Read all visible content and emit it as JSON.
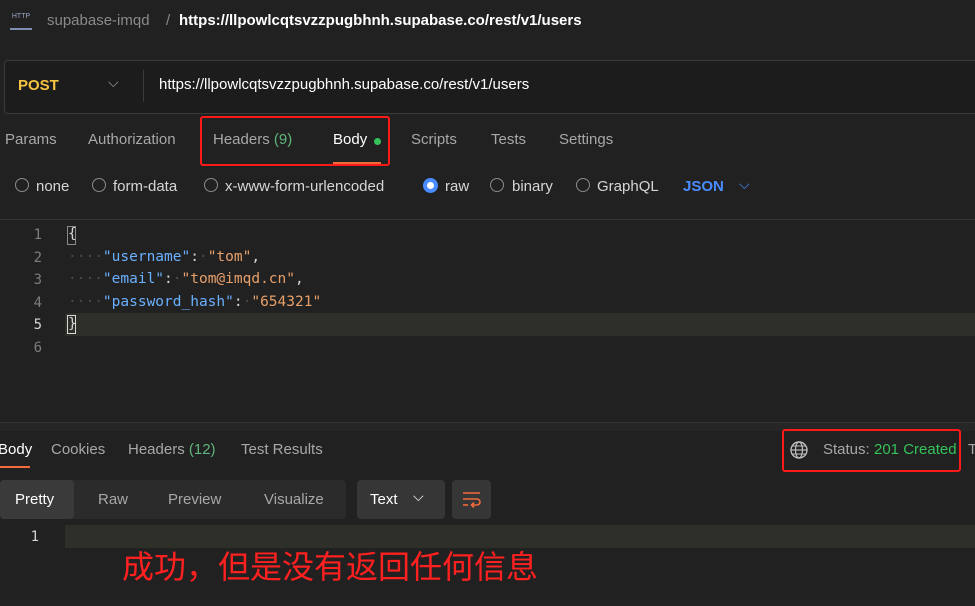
{
  "breadcrumb": {
    "icon": "http-request-icon",
    "icon_text": "HTTP",
    "collection": "supabase-imqd",
    "separator": "/",
    "request_name": "https://llpowlcqtsvzzpugbhnh.supabase.co/rest/v1/users"
  },
  "request": {
    "method": "POST",
    "url": "https://llpowlcqtsvzzpugbhnh.supabase.co/rest/v1/users",
    "method_color": "#f5c342"
  },
  "request_tabs": {
    "params": "Params",
    "authorization": "Authorization",
    "headers": "Headers",
    "headers_count": "(9)",
    "body": "Body",
    "scripts": "Scripts",
    "tests": "Tests",
    "settings": "Settings",
    "active": "Body"
  },
  "body_types": {
    "none": "none",
    "form_data": "form-data",
    "urlencoded": "x-www-form-urlencoded",
    "raw": "raw",
    "binary": "binary",
    "graphql": "GraphQL",
    "selected": "raw",
    "language": "JSON"
  },
  "editor": {
    "line_numbers": [
      "1",
      "2",
      "3",
      "4",
      "5",
      "6"
    ],
    "open_brace": "{",
    "close_brace": "}",
    "indent": "····",
    "username_key": "\"username\"",
    "username_val": "\"tom\"",
    "email_key": "\"email\"",
    "email_val": "\"tom@imqd.cn\"",
    "password_key": "\"password_hash\"",
    "password_val": "\"654321\"",
    "colon": ":",
    "comma": ","
  },
  "response_tabs": {
    "body": "Body",
    "cookies": "Cookies",
    "headers": "Headers",
    "headers_count": "(12)",
    "test_results": "Test Results",
    "active": "Body"
  },
  "response_status": {
    "label": "Status:",
    "value": "201 Created",
    "color": "#35c25a",
    "overflow": "T"
  },
  "response_view": {
    "pretty": "Pretty",
    "raw": "Raw",
    "preview": "Preview",
    "visualize": "Visualize",
    "format": "Text",
    "active": "Pretty",
    "line_numbers": [
      "1"
    ]
  },
  "annotation": {
    "text": "成功，但是没有返回任何信息",
    "color": "#ff2020"
  },
  "highlight_color": "#ff1a1a",
  "accent_color": "#f26b3a"
}
